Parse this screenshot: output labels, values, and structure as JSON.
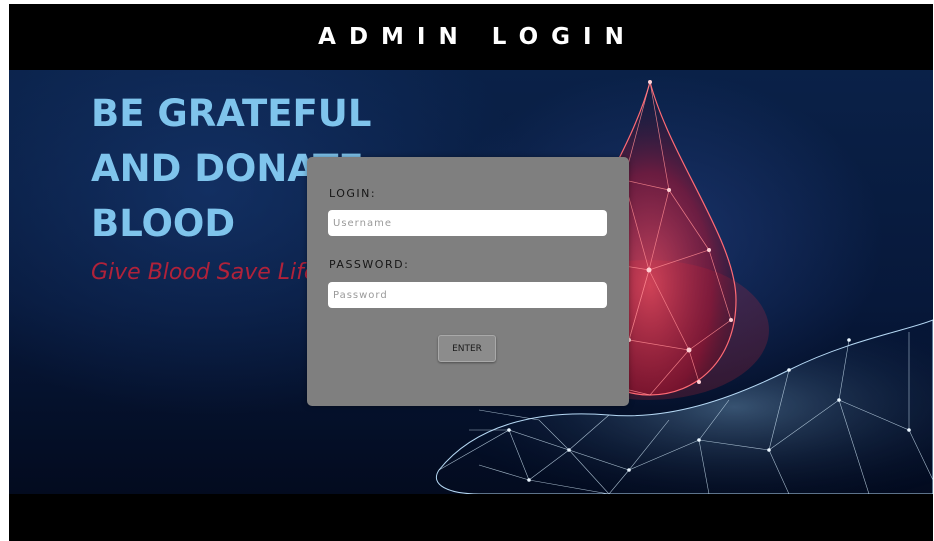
{
  "header": {
    "title": "ADMIN LOGIN"
  },
  "hero": {
    "headline": [
      "BE GRATEFUL",
      "AND DONATE",
      "BLOOD"
    ],
    "tagline": "Give Blood  Save Life"
  },
  "login_form": {
    "login_label": "LOGIN:",
    "username_placeholder": "Username",
    "password_label": "PASSWORD:",
    "password_placeholder": "Password",
    "enter_label": "ENTER"
  },
  "colors": {
    "header_background": "#000000",
    "headline": "#7fc4ec",
    "tagline": "#b0223a",
    "panel": "#7f7f7f",
    "drop": "#e8283c",
    "hand": "#cfe8ff"
  },
  "icons": [
    "blood-drop-icon",
    "hand-icon"
  ]
}
